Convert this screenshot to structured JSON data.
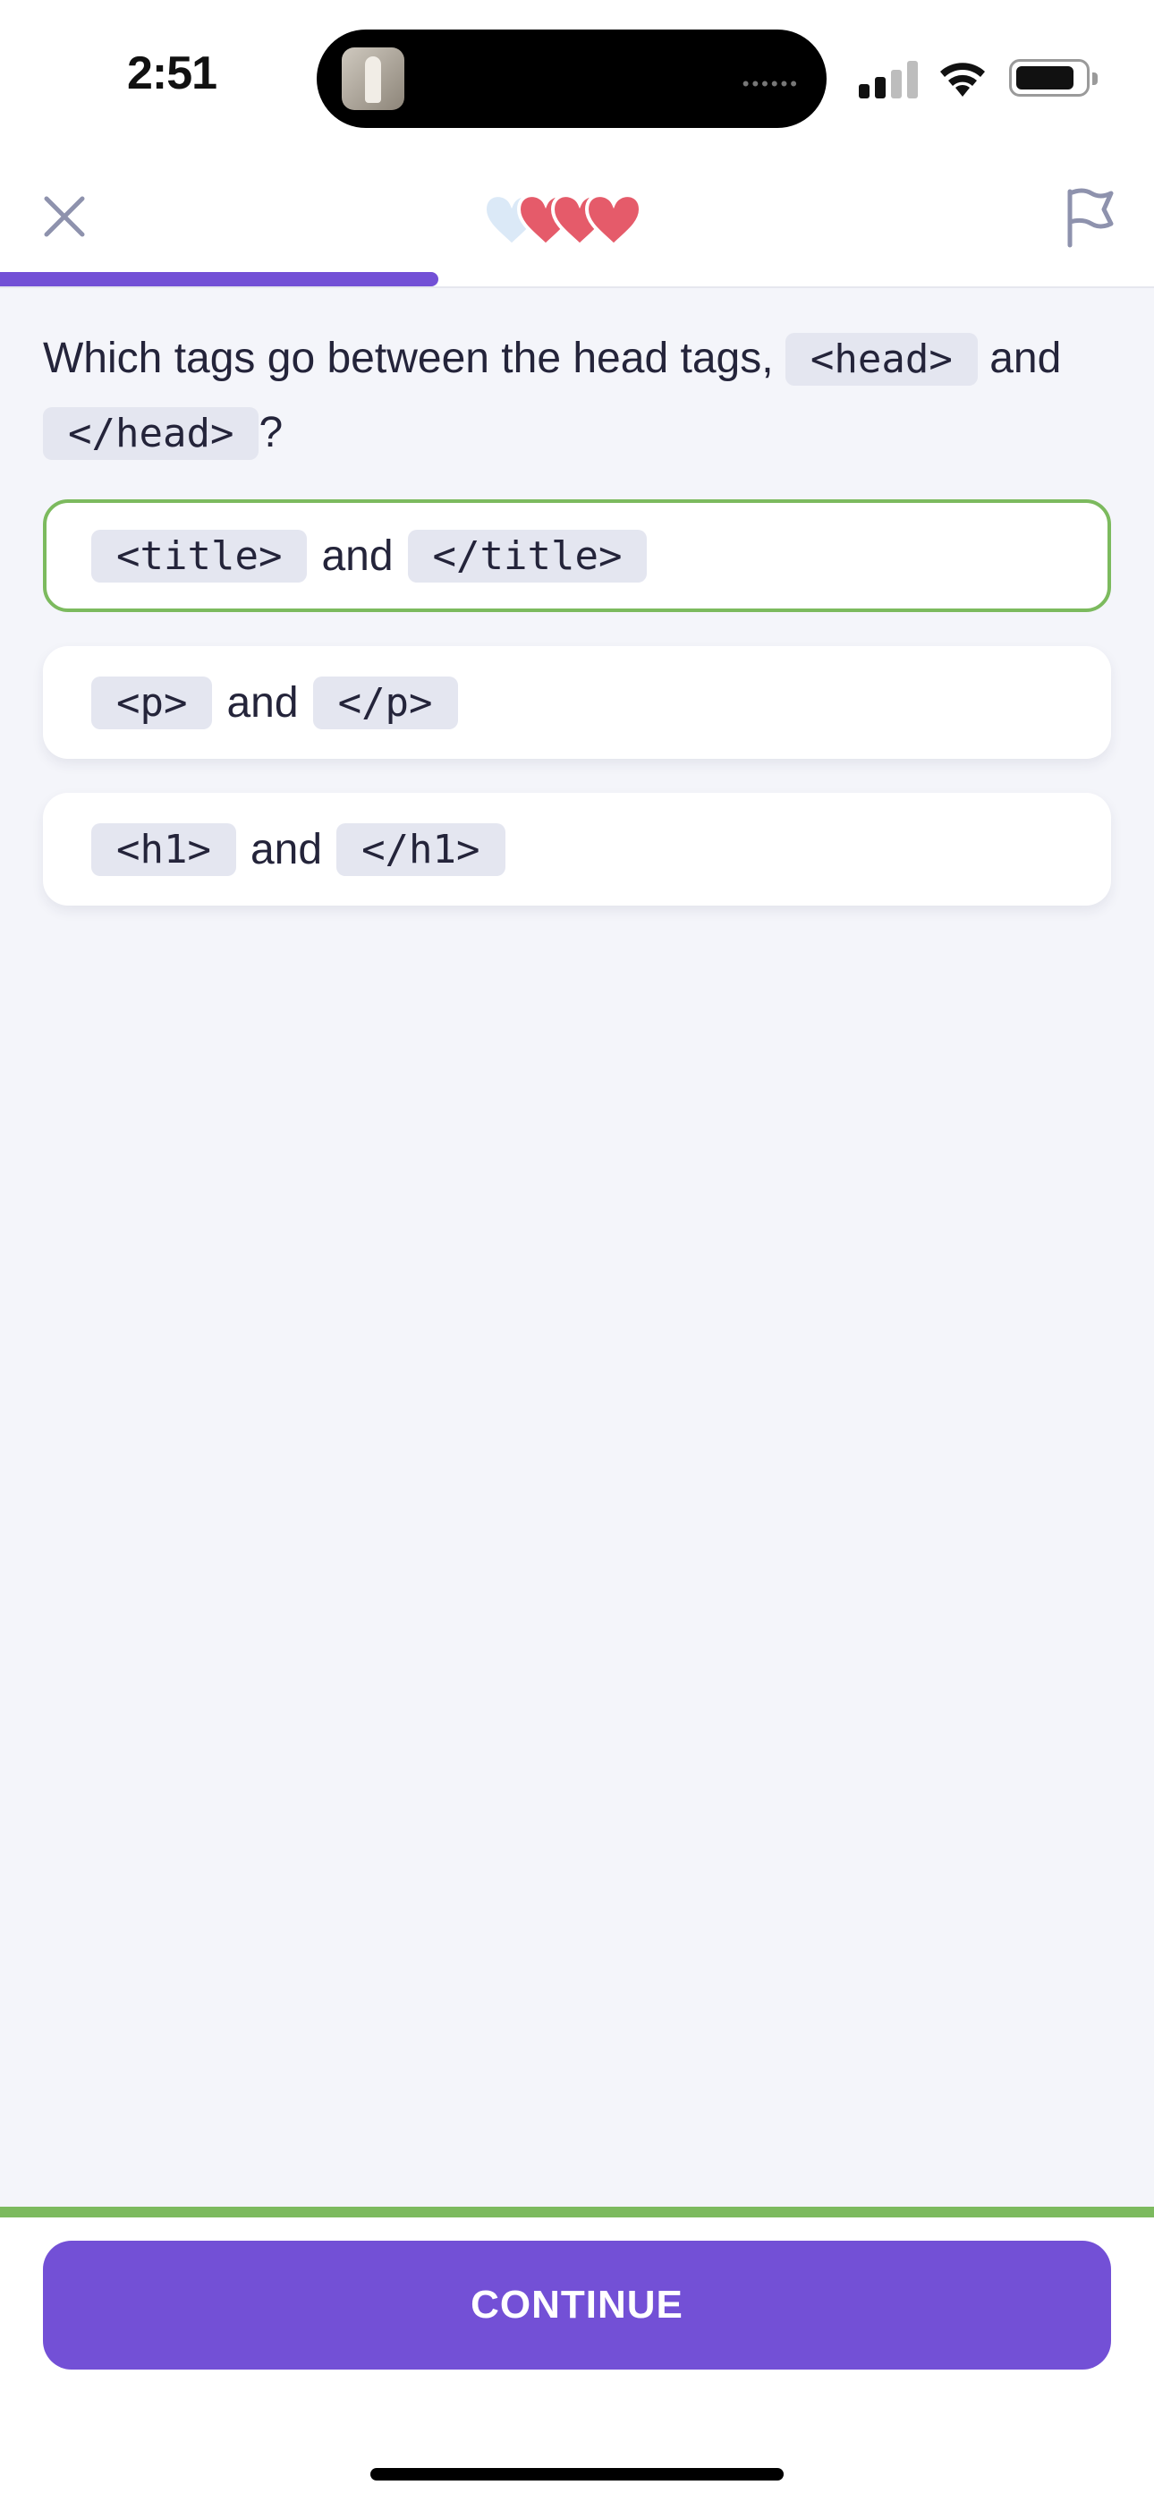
{
  "status_bar": {
    "time": "2:51",
    "island_dots": "••••••"
  },
  "header": {
    "close_icon": "close-icon",
    "flag_icon": "flag-icon",
    "hearts": {
      "total": 4,
      "lost": 1,
      "full_color": "#e55b6a",
      "empty_color": "#dbe9f7"
    },
    "progress": {
      "fraction": 0.38,
      "color": "#7350d6"
    }
  },
  "question": {
    "text_before": "Which tags go between the head tags,",
    "code_open": "<head>",
    "text_middle": "and",
    "code_close": "</head>",
    "text_after": "?"
  },
  "options": [
    {
      "code_a": "<title>",
      "joiner": "and",
      "code_b": "</title>",
      "selected": true
    },
    {
      "code_a": "<p>",
      "joiner": "and",
      "code_b": "</p>",
      "selected": false
    },
    {
      "code_a": "<h1>",
      "joiner": "and",
      "code_b": "</h1>",
      "selected": false
    }
  ],
  "footer": {
    "continue_label": "CONTINUE",
    "accent": "#7cba5e"
  }
}
